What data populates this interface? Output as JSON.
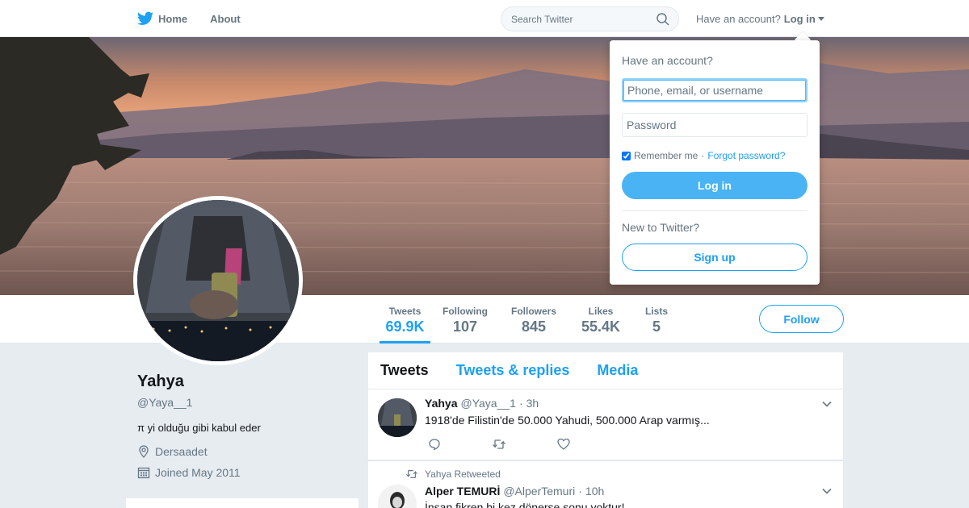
{
  "nav": {
    "home_label": "Home",
    "about_label": "About",
    "search_placeholder": "Search Twitter",
    "account_question": "Have an account?",
    "login_label": "Log in"
  },
  "profile_nav": {
    "stats": [
      {
        "label": "Tweets",
        "value": "69.9K",
        "active": true
      },
      {
        "label": "Following",
        "value": "107"
      },
      {
        "label": "Followers",
        "value": "845"
      },
      {
        "label": "Likes",
        "value": "55.4K"
      },
      {
        "label": "Lists",
        "value": "5"
      }
    ],
    "follow_label": "Follow"
  },
  "profile": {
    "name": "Yahya",
    "handle": "@Yaya__1",
    "bio": "π yi olduğu gibi kabul eder",
    "location": "Dersaadet",
    "joined": "Joined May 2011"
  },
  "timeline": {
    "tabs": [
      "Tweets",
      "Tweets & replies",
      "Media"
    ],
    "tweets": [
      {
        "name": "Yahya",
        "handle": "@Yaya__1",
        "time": "3h",
        "text": "1918'de Filistin'de 50.000 Yahudi, 500.000 Arap varmış..."
      },
      {
        "retweet_context": "Yahya Retweeted",
        "name": "Alper TEMURİ",
        "handle": "@AlperTemuri",
        "time": "10h",
        "text": "İnsan fikren bi kez dönerse sonu yoktur!"
      }
    ]
  },
  "login_dropdown": {
    "title": "Have an account?",
    "username_placeholder": "Phone, email, or username",
    "password_placeholder": "Password",
    "remember_label": "Remember me",
    "separator": "·",
    "forgot_label": "Forgot password?",
    "login_button": "Log in",
    "new_prompt": "New to Twitter?",
    "signup_button": "Sign up"
  },
  "colors": {
    "brand": "#1da1f2",
    "login_button_bg": "#4ab3f4",
    "background": "#e6ecf0"
  },
  "icons": [
    "twitter-bird-icon",
    "home-icon",
    "search-icon",
    "caret-down-icon",
    "location-pin-icon",
    "calendar-icon",
    "reply-icon",
    "retweet-icon",
    "like-icon",
    "chevron-down-icon"
  ]
}
